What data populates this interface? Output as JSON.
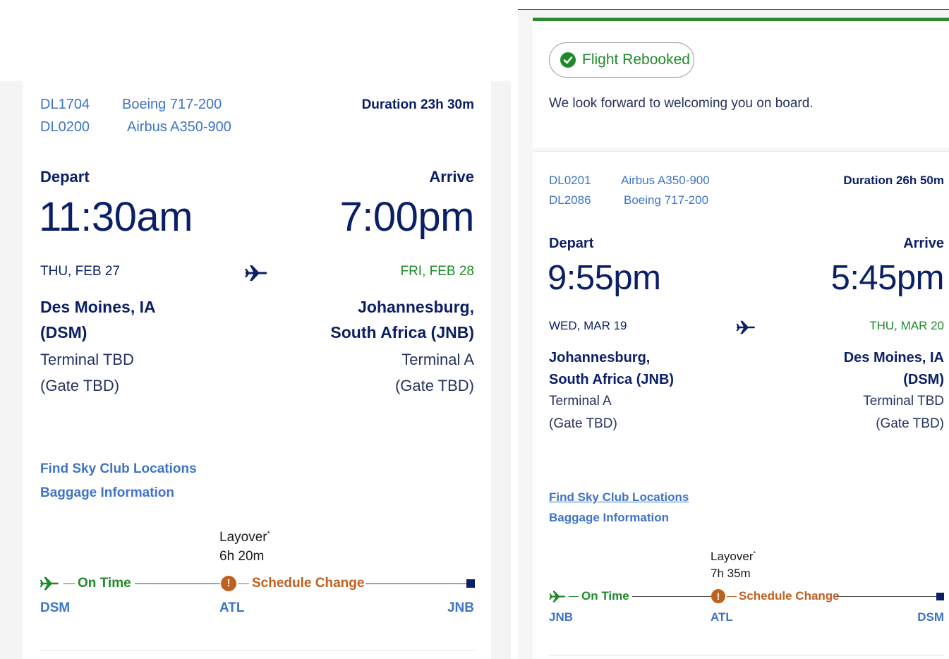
{
  "left": {
    "flights": [
      {
        "number": "DL1704",
        "aircraft": "Boeing 717-200"
      },
      {
        "number": "DL0200",
        "aircraft": "Airbus A350-900"
      }
    ],
    "duration": "Duration 23h 30m",
    "depart_label": "Depart",
    "arrive_label": "Arrive",
    "depart_time": "11:30am",
    "arrive_time": "7:00pm",
    "depart_date": "THU, FEB 27",
    "arrive_date": "FRI, FEB 28",
    "origin_city_1": "Des Moines, IA",
    "origin_city_2": "(DSM)",
    "origin_terminal": "Terminal TBD",
    "origin_gate": "(Gate TBD)",
    "dest_city_1": "Johannesburg,",
    "dest_city_2": "South Africa (JNB)",
    "dest_terminal": "Terminal A",
    "dest_gate": "(Gate TBD)",
    "link_sky_club": "Find Sky Club Locations",
    "link_baggage": "Baggage Information",
    "layover_label": "Layover",
    "layover_asterisk": "*",
    "layover_duration": "6h 20m",
    "status_on_time": "On Time",
    "status_change": "Schedule Change",
    "alert_glyph": "!",
    "code_origin": "DSM",
    "code_stop": "ATL",
    "code_dest": "JNB"
  },
  "right": {
    "status_badge": "Flight Rebooked",
    "welcome": "We look forward to welcoming you on board.",
    "flights": [
      {
        "number": "DL0201",
        "aircraft": "Airbus A350-900"
      },
      {
        "number": "DL2086",
        "aircraft": "Boeing 717-200"
      }
    ],
    "duration": "Duration 26h 50m",
    "depart_label": "Depart",
    "arrive_label": "Arrive",
    "depart_time": "9:55pm",
    "arrive_time": "5:45pm",
    "depart_date": "WED, MAR 19",
    "arrive_date": "THU, MAR 20",
    "origin_city_1": "Johannesburg,",
    "origin_city_2": "South Africa (JNB)",
    "origin_terminal": "Terminal A",
    "origin_gate": "(Gate TBD)",
    "dest_city_1": "Des Moines, IA",
    "dest_city_2": "(DSM)",
    "dest_terminal": "Terminal TBD",
    "dest_gate": "(Gate TBD)",
    "link_sky_club": "Find Sky Club Locations",
    "link_baggage": "Baggage Information",
    "layover_label": "Layover",
    "layover_asterisk": "*",
    "layover_duration": "7h 35m",
    "status_on_time": "On Time",
    "status_change": "Schedule Change",
    "alert_glyph": "!",
    "code_origin": "JNB",
    "code_stop": "ATL",
    "code_dest": "DSM"
  },
  "colors": {
    "navy": "#0b1f66",
    "link_blue": "#3f73c6",
    "green": "#1f8a2a",
    "orange": "#c0601f"
  },
  "icons": [
    "plane-icon",
    "check-circle-icon",
    "alert-icon"
  ]
}
